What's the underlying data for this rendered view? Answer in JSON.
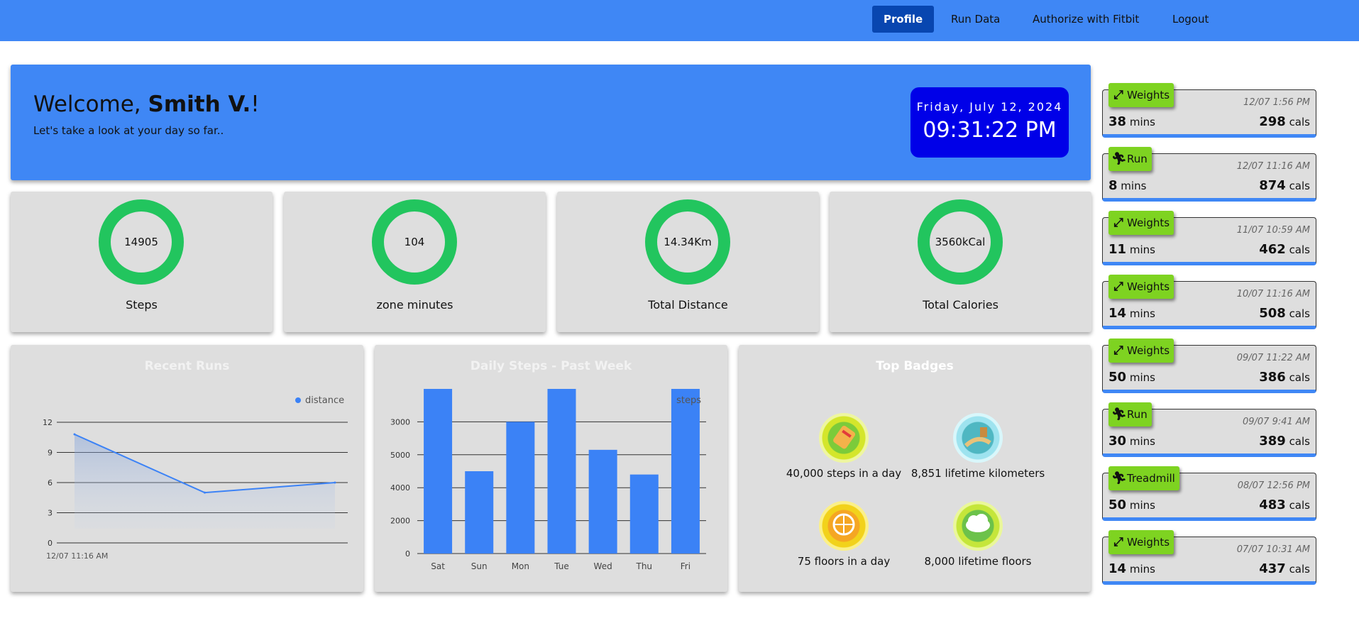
{
  "nav": {
    "items": [
      "Profile",
      "Run Data",
      "Authorize with Fitbit",
      "Logout"
    ],
    "active": "Profile"
  },
  "welcome": {
    "greeting": "Welcome, ",
    "name": "Smith V.",
    "exclaim": "!",
    "subtitle": "Let's take a look at your day so far.."
  },
  "clock": {
    "date": "Friday, July 12, 2024",
    "time": "09:31:22 PM"
  },
  "stats": [
    {
      "value": "14905",
      "label": "Steps"
    },
    {
      "value": "104",
      "label": "zone minutes"
    },
    {
      "value": "14.34Km",
      "label": "Total Distance"
    },
    {
      "value": "3560kCal",
      "label": "Total Calories"
    }
  ],
  "colors": {
    "nav": "#3f87f5",
    "ring": "#22c55e",
    "tag": "#7ed321",
    "clock": "#0000e8",
    "card": "#dedede",
    "series": "#3b82f6"
  },
  "recent_runs": {
    "title": "Recent Runs",
    "chart_data": {
      "type": "area",
      "title": "Recent Runs",
      "legend": [
        "distance"
      ],
      "legend_position": "top-right",
      "x_tick_labels": [
        "12/07 11:16 AM"
      ],
      "yticks": [
        0,
        3,
        6,
        12,
        9
      ],
      "ylim": [
        0,
        12
      ],
      "series": [
        {
          "name": "distance",
          "values": [
            10.8,
            5,
            6
          ]
        }
      ],
      "grid": true
    }
  },
  "daily_steps": {
    "title": "Daily Steps - Past Week",
    "chart_data": {
      "type": "bar",
      "title": "Daily Steps - Past Week",
      "legend": [
        "steps"
      ],
      "legend_position": "top-right",
      "categories": [
        "Sat",
        "Sun",
        "Mon",
        "Tue",
        "Wed",
        "Thu",
        "Fri"
      ],
      "series": [
        {
          "name": "steps",
          "values": [
            10000,
            5000,
            8000,
            10000,
            6300,
            4800,
            10000
          ]
        }
      ],
      "yticks": [
        0,
        2000,
        4000,
        6000,
        8000
      ],
      "ytick_labels": [
        "0",
        "2000",
        "4000",
        "5000",
        "3000"
      ],
      "ylim": [
        0,
        10000
      ],
      "grid": true
    }
  },
  "badges": {
    "title": "Top Badges",
    "items": [
      {
        "label": "40,000 steps in a day",
        "icon": "sneaker-icon",
        "color": "#d4e62b"
      },
      {
        "label": "8,851 lifetime kilometers",
        "icon": "great-wall-icon",
        "color": "#9ee3ef"
      },
      {
        "label": "75 floors in a day",
        "icon": "ferris-wheel-icon",
        "color": "#f2d21b"
      },
      {
        "label": "8,000 lifetime floors",
        "icon": "cloud-icon",
        "color": "#c5e63a"
      }
    ]
  },
  "activities": [
    {
      "type": "Weights",
      "icon": "weights-icon",
      "time": "12/07 1:56 PM",
      "mins": "38",
      "cals": "298"
    },
    {
      "type": "Run",
      "icon": "run-icon",
      "time": "12/07 11:16 AM",
      "mins": "8",
      "cals": "874"
    },
    {
      "type": "Weights",
      "icon": "weights-icon",
      "time": "11/07 10:59 AM",
      "mins": "11",
      "cals": "462"
    },
    {
      "type": "Weights",
      "icon": "weights-icon",
      "time": "10/07 11:16 AM",
      "mins": "14",
      "cals": "508"
    },
    {
      "type": "Weights",
      "icon": "weights-icon",
      "time": "09/07 11:22 AM",
      "mins": "50",
      "cals": "386"
    },
    {
      "type": "Run",
      "icon": "run-icon",
      "time": "09/07 9:41 AM",
      "mins": "30",
      "cals": "389"
    },
    {
      "type": "Treadmill",
      "icon": "run-icon",
      "time": "08/07 12:56 PM",
      "mins": "50",
      "cals": "483"
    },
    {
      "type": "Weights",
      "icon": "weights-icon",
      "time": "07/07 10:31 AM",
      "mins": "14",
      "cals": "437"
    }
  ],
  "units": {
    "mins": "mins",
    "cals": "cals"
  }
}
